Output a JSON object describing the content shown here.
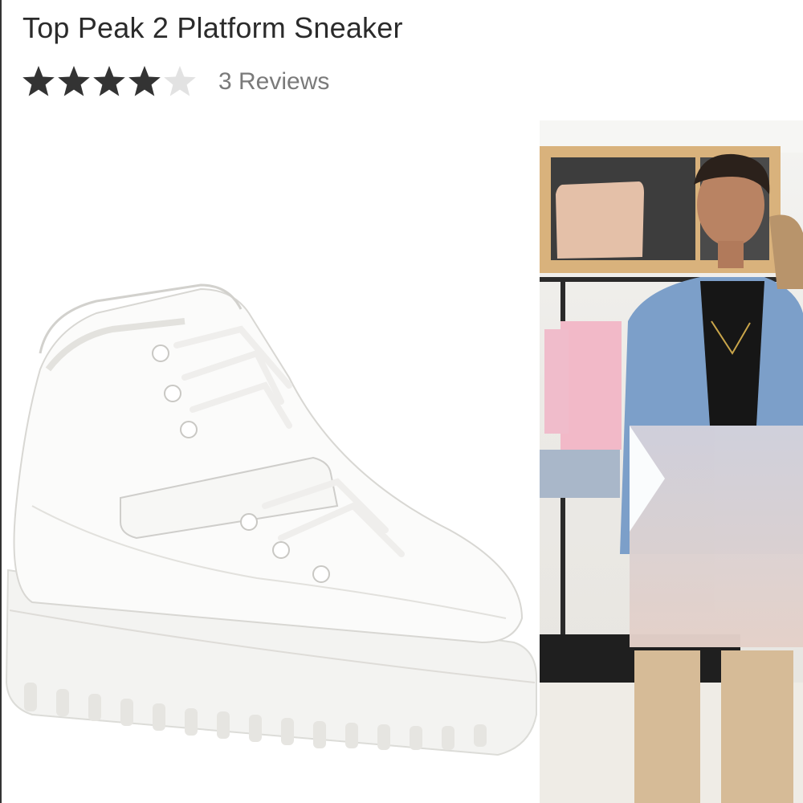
{
  "product": {
    "title": "Top Peak 2 Platform Sneaker",
    "rating": {
      "value": 4,
      "max": 5,
      "reviews_label": "3 Reviews"
    }
  },
  "images": {
    "main": "white-platform-sneaker-image",
    "video": "store-video-thumbnail"
  },
  "icons": {
    "star": "star-icon",
    "play": "play-icon"
  },
  "colors": {
    "title_text": "#2b2b2b",
    "star_filled": "#333333",
    "star_empty": "#e2e2e2",
    "reviews_text": "#7a7a7a"
  }
}
